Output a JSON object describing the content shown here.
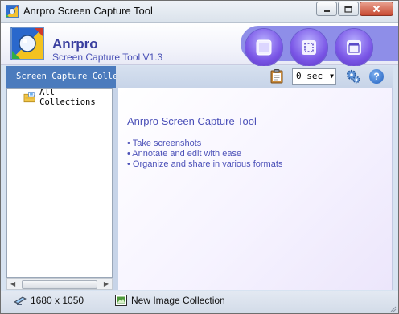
{
  "window": {
    "title": "Anrpro Screen Capture Tool",
    "controls": [
      "minimize",
      "maximize",
      "close"
    ]
  },
  "header": {
    "brand_name": "Anrpro",
    "brand_version": "Screen Capture Tool V1.3",
    "capture_buttons": [
      {
        "icon": "capture-window-icon"
      },
      {
        "icon": "capture-region-icon"
      },
      {
        "icon": "capture-fullscreen-icon"
      }
    ],
    "accent_color": "#8e8ee8",
    "brand_color": "#3a3f9f"
  },
  "toolbar": {
    "sidebar_title": "Screen Capture Collections",
    "delay_select": {
      "value": "0 sec"
    },
    "icons": [
      "clipboard-icon",
      "gear-icon",
      "help-icon"
    ],
    "help_glyph": "?"
  },
  "sidebar": {
    "items": [
      {
        "label": "All Collections",
        "icon": "folder-collection-icon",
        "selected": true
      }
    ],
    "header_color": "#4b7bbd"
  },
  "main": {
    "title": "Anrpro Screen Capture Tool",
    "features": [
      "• Take screenshots",
      "• Annotate and edit with ease",
      "• Organize and share in various formats"
    ],
    "text_color": "#4b50b8"
  },
  "statusbar": {
    "resolution": "1680 x 1050",
    "collection_button": "New Image Collection"
  }
}
